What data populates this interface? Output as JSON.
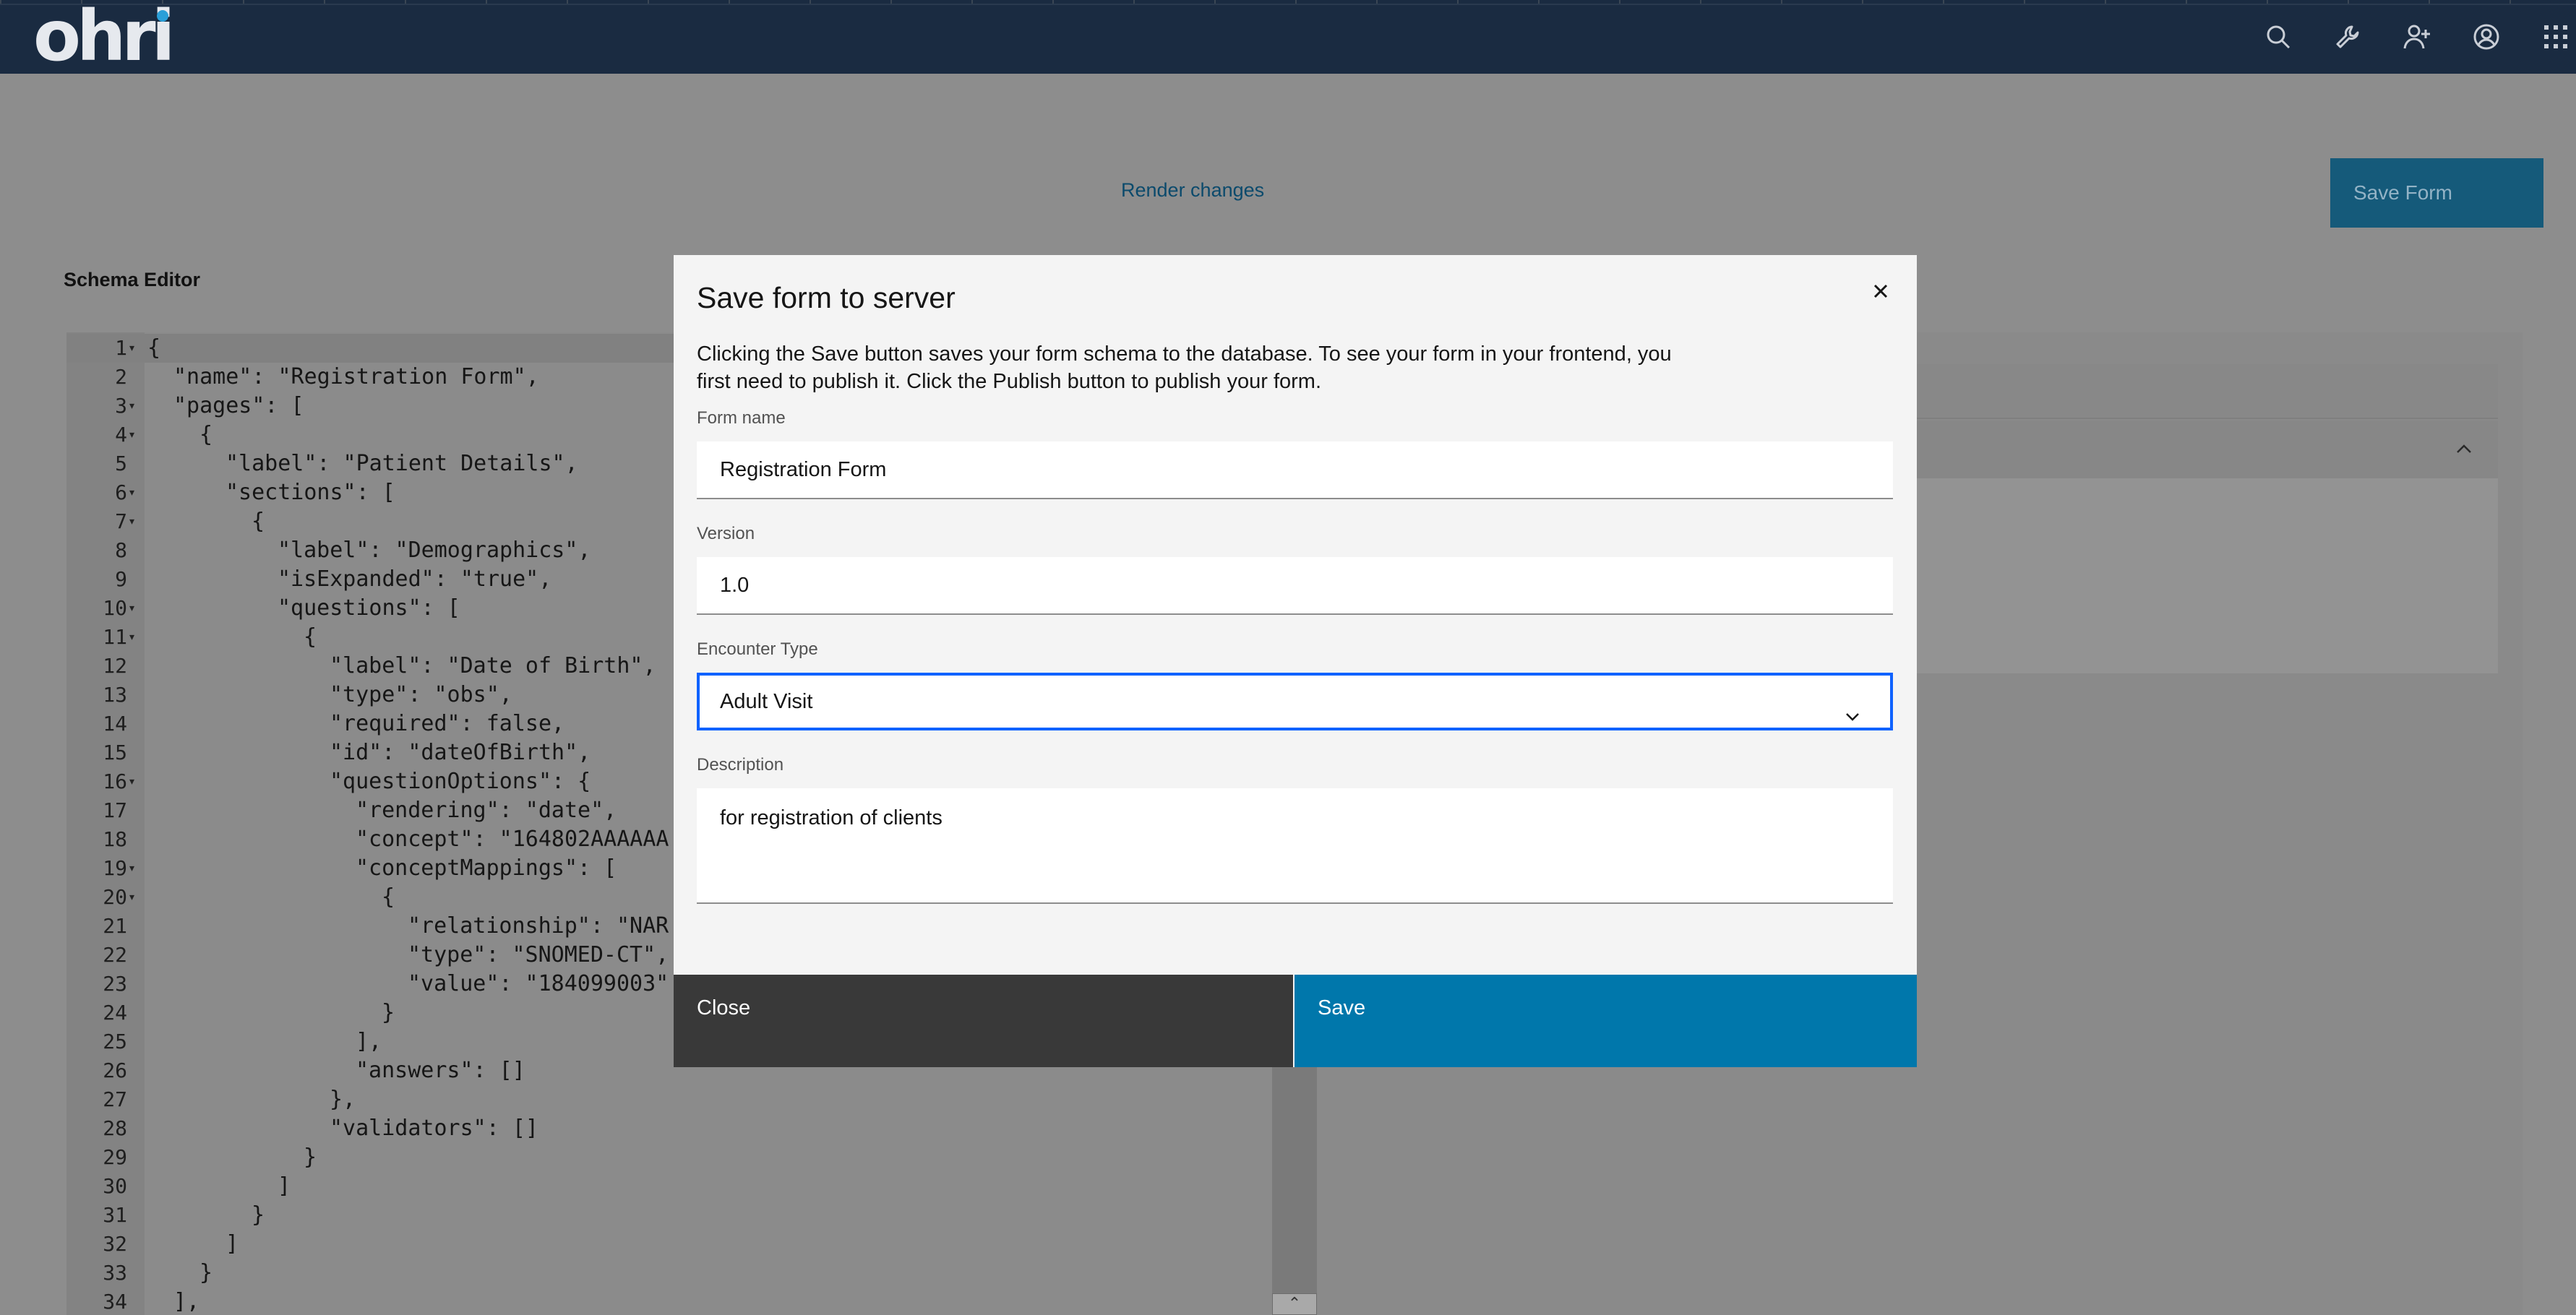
{
  "header": {
    "logo": "ohri",
    "icons": [
      "search-icon",
      "wrench-icon",
      "add-user-icon",
      "user-avatar-icon",
      "app-switcher-icon"
    ]
  },
  "toolbar": {
    "render_changes": "Render changes",
    "save_form": "Save Form"
  },
  "schema_editor": {
    "title": "Schema Editor",
    "active_line": 1,
    "lines": [
      {
        "n": "1",
        "fold": true,
        "indent": 0,
        "text": "{"
      },
      {
        "n": "2",
        "fold": false,
        "indent": 1,
        "text": "\"name\": \"Registration Form\","
      },
      {
        "n": "3",
        "fold": true,
        "indent": 1,
        "text": "\"pages\": ["
      },
      {
        "n": "4",
        "fold": true,
        "indent": 2,
        "text": "{"
      },
      {
        "n": "5",
        "fold": false,
        "indent": 3,
        "text": "\"label\": \"Patient Details\","
      },
      {
        "n": "6",
        "fold": true,
        "indent": 3,
        "text": "\"sections\": ["
      },
      {
        "n": "7",
        "fold": true,
        "indent": 4,
        "text": "{"
      },
      {
        "n": "8",
        "fold": false,
        "indent": 5,
        "text": "\"label\": \"Demographics\","
      },
      {
        "n": "9",
        "fold": false,
        "indent": 5,
        "text": "\"isExpanded\": \"true\","
      },
      {
        "n": "10",
        "fold": true,
        "indent": 5,
        "text": "\"questions\": ["
      },
      {
        "n": "11",
        "fold": true,
        "indent": 6,
        "text": "{"
      },
      {
        "n": "12",
        "fold": false,
        "indent": 7,
        "text": "\"label\": \"Date of Birth\","
      },
      {
        "n": "13",
        "fold": false,
        "indent": 7,
        "text": "\"type\": \"obs\","
      },
      {
        "n": "14",
        "fold": false,
        "indent": 7,
        "text": "\"required\": false,"
      },
      {
        "n": "15",
        "fold": false,
        "indent": 7,
        "text": "\"id\": \"dateOfBirth\","
      },
      {
        "n": "16",
        "fold": true,
        "indent": 7,
        "text": "\"questionOptions\": {"
      },
      {
        "n": "17",
        "fold": false,
        "indent": 8,
        "text": "\"rendering\": \"date\","
      },
      {
        "n": "18",
        "fold": false,
        "indent": 8,
        "text": "\"concept\": \"164802AAAAAA"
      },
      {
        "n": "19",
        "fold": true,
        "indent": 8,
        "text": "\"conceptMappings\": ["
      },
      {
        "n": "20",
        "fold": true,
        "indent": 9,
        "text": "{"
      },
      {
        "n": "21",
        "fold": false,
        "indent": 10,
        "text": "\"relationship\": \"NAR"
      },
      {
        "n": "22",
        "fold": false,
        "indent": 10,
        "text": "\"type\": \"SNOMED-CT\","
      },
      {
        "n": "23",
        "fold": false,
        "indent": 10,
        "text": "\"value\": \"184099003\""
      },
      {
        "n": "24",
        "fold": false,
        "indent": 9,
        "text": "}"
      },
      {
        "n": "25",
        "fold": false,
        "indent": 8,
        "text": "],"
      },
      {
        "n": "26",
        "fold": false,
        "indent": 8,
        "text": "\"answers\": []"
      },
      {
        "n": "27",
        "fold": false,
        "indent": 7,
        "text": "},"
      },
      {
        "n": "28",
        "fold": false,
        "indent": 7,
        "text": "\"validators\": []"
      },
      {
        "n": "29",
        "fold": false,
        "indent": 6,
        "text": "}"
      },
      {
        "n": "30",
        "fold": false,
        "indent": 5,
        "text": "]"
      },
      {
        "n": "31",
        "fold": false,
        "indent": 4,
        "text": "}"
      },
      {
        "n": "32",
        "fold": false,
        "indent": 3,
        "text": "]"
      },
      {
        "n": "33",
        "fold": false,
        "indent": 2,
        "text": "}"
      },
      {
        "n": "34",
        "fold": false,
        "indent": 1,
        "text": "],"
      }
    ]
  },
  "modal": {
    "title": "Save form to server",
    "description_line1": "Clicking the Save button saves your form schema to the database. To see your form in your frontend, you",
    "description_line2": "first need to publish it. Click the Publish button to publish your form.",
    "form_name_label": "Form name",
    "form_name_value": "Registration Form",
    "version_label": "Version",
    "version_value": "1.0",
    "encounter_type_label": "Encounter Type",
    "encounter_type_value": "Adult Visit",
    "description_label": "Description",
    "description_value": "for registration of clients",
    "close_label": "Close",
    "save_label": "Save"
  },
  "colors": {
    "header_bg": "#1a2b41",
    "overlay": "#8d8d8d",
    "primary": "#0077ab",
    "focus": "#0f62fe",
    "secondary_button": "#393939"
  }
}
